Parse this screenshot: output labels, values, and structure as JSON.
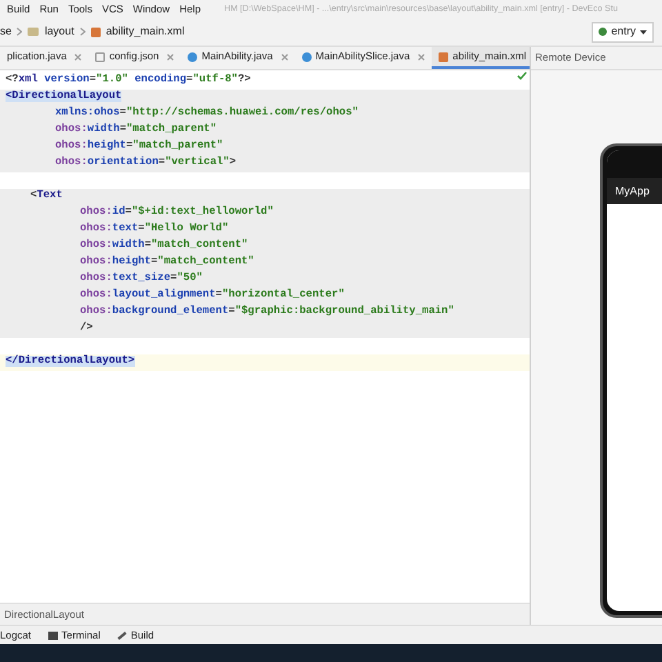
{
  "menu_bar": {
    "items": [
      "Build",
      "Run",
      "Tools",
      "VCS",
      "Window",
      "Help"
    ],
    "title": "HM [D:\\WebSpace\\HM] - ...\\entry\\src\\main\\resources\\base\\layout\\ability_main.xml [entry] - DevEco Stu"
  },
  "breadcrumb": [
    "se",
    "layout",
    "ability_main.xml"
  ],
  "run_config": "entry",
  "tabs": [
    {
      "label": "plication.java",
      "kind": "java",
      "selected": false
    },
    {
      "label": "config.json",
      "kind": "json",
      "selected": false
    },
    {
      "label": "MainAbility.java",
      "kind": "class",
      "selected": false
    },
    {
      "label": "MainAbilitySlice.java",
      "kind": "class",
      "selected": false
    },
    {
      "label": "ability_main.xml",
      "kind": "xml",
      "selected": true
    }
  ],
  "editor": {
    "lines": [
      {
        "kind": "element",
        "highlighted": false,
        "current": false,
        "tokens": [
          {
            "kind": "punct",
            "text": "<?"
          },
          {
            "kind": "tag",
            "text": "xml "
          },
          {
            "kind": "attr",
            "text": "version"
          },
          {
            "kind": "punct",
            "text": "="
          },
          {
            "kind": "value",
            "text": "\"1.0\" "
          },
          {
            "kind": "attr",
            "text": "encoding"
          },
          {
            "kind": "punct",
            "text": "="
          },
          {
            "kind": "value",
            "text": "\"utf-8\""
          },
          {
            "kind": "punct",
            "text": "?>"
          }
        ]
      },
      {
        "kind": "element",
        "highlighted": true,
        "current": false,
        "tokens": [
          {
            "kind": "match",
            "text": "<DirectionalLayout"
          }
        ],
        "children": [
          {
            "kind": "attribute",
            "highlighted": true,
            "current": false,
            "tokens": [
              {
                "kind": "attr",
                "text": "xmlns:ohos"
              },
              {
                "kind": "punct",
                "text": "="
              },
              {
                "kind": "value",
                "text": "\"http://schemas.huawei.com/res/ohos\""
              }
            ]
          },
          {
            "kind": "attribute",
            "highlighted": true,
            "current": false,
            "tokens": [
              {
                "kind": "ns",
                "text": "ohos:"
              },
              {
                "kind": "attr",
                "text": "width"
              },
              {
                "kind": "punct",
                "text": "="
              },
              {
                "kind": "value",
                "text": "\"match_parent\""
              }
            ]
          },
          {
            "kind": "attribute",
            "highlighted": true,
            "current": false,
            "tokens": [
              {
                "kind": "ns",
                "text": "ohos:"
              },
              {
                "kind": "attr",
                "text": "height"
              },
              {
                "kind": "punct",
                "text": "="
              },
              {
                "kind": "value",
                "text": "\"match_parent\""
              }
            ]
          },
          {
            "kind": "attribute",
            "highlighted": true,
            "current": false,
            "tokens": [
              {
                "kind": "ns",
                "text": "ohos:"
              },
              {
                "kind": "attr",
                "text": "orientation"
              },
              {
                "kind": "punct",
                "text": "="
              },
              {
                "kind": "value",
                "text": "\"vertical\""
              },
              {
                "kind": "punct",
                "text": ">"
              }
            ]
          },
          {
            "kind": "blank",
            "highlighted": false,
            "current": false
          },
          {
            "kind": "element",
            "highlighted": true,
            "current": false,
            "tokens": [
              {
                "kind": "punct",
                "text": "<"
              },
              {
                "kind": "tag",
                "text": "Text"
              }
            ],
            "children": [
              {
                "kind": "attribute",
                "highlighted": true,
                "current": false,
                "tokens": [
                  {
                    "kind": "ns",
                    "text": "ohos:"
                  },
                  {
                    "kind": "attr",
                    "text": "id"
                  },
                  {
                    "kind": "punct",
                    "text": "="
                  },
                  {
                    "kind": "value",
                    "text": "\"$+id:text_helloworld\""
                  }
                ]
              },
              {
                "kind": "attribute",
                "highlighted": true,
                "current": false,
                "tokens": [
                  {
                    "kind": "ns",
                    "text": "ohos:"
                  },
                  {
                    "kind": "attr",
                    "text": "text"
                  },
                  {
                    "kind": "punct",
                    "text": "="
                  },
                  {
                    "kind": "value",
                    "text": "\"Hello World\""
                  }
                ]
              },
              {
                "kind": "attribute",
                "highlighted": true,
                "current": false,
                "tokens": [
                  {
                    "kind": "ns",
                    "text": "ohos:"
                  },
                  {
                    "kind": "attr",
                    "text": "width"
                  },
                  {
                    "kind": "punct",
                    "text": "="
                  },
                  {
                    "kind": "value",
                    "text": "\"match_content\""
                  }
                ]
              },
              {
                "kind": "attribute",
                "highlighted": true,
                "current": false,
                "tokens": [
                  {
                    "kind": "ns",
                    "text": "ohos:"
                  },
                  {
                    "kind": "attr",
                    "text": "height"
                  },
                  {
                    "kind": "punct",
                    "text": "="
                  },
                  {
                    "kind": "value",
                    "text": "\"match_content\""
                  }
                ]
              },
              {
                "kind": "attribute",
                "highlighted": true,
                "current": false,
                "tokens": [
                  {
                    "kind": "ns",
                    "text": "ohos:"
                  },
                  {
                    "kind": "attr",
                    "text": "text_size"
                  },
                  {
                    "kind": "punct",
                    "text": "="
                  },
                  {
                    "kind": "value",
                    "text": "\"50\""
                  }
                ]
              },
              {
                "kind": "attribute",
                "highlighted": true,
                "current": false,
                "tokens": [
                  {
                    "kind": "ns",
                    "text": "ohos:"
                  },
                  {
                    "kind": "attr",
                    "text": "layout_alignment"
                  },
                  {
                    "kind": "punct",
                    "text": "="
                  },
                  {
                    "kind": "value",
                    "text": "\"horizontal_center\""
                  }
                ]
              },
              {
                "kind": "attribute",
                "highlighted": true,
                "current": false,
                "tokens": [
                  {
                    "kind": "ns",
                    "text": "ohos:"
                  },
                  {
                    "kind": "attr",
                    "text": "background_element"
                  },
                  {
                    "kind": "punct",
                    "text": "="
                  },
                  {
                    "kind": "value",
                    "text": "\"$graphic:background_ability_main\""
                  }
                ]
              },
              {
                "kind": "attribute",
                "highlighted": true,
                "current": false,
                "tokens": [
                  {
                    "kind": "punct",
                    "text": "/>"
                  }
                ]
              }
            ]
          },
          {
            "kind": "blank",
            "highlighted": false,
            "current": false
          }
        ]
      },
      {
        "kind": "element",
        "highlighted": false,
        "current": true,
        "tokens": [
          {
            "kind": "match",
            "text": "</DirectionalLayout>"
          }
        ]
      }
    ]
  },
  "editor_breadcrumb": "DirectionalLayout",
  "remote_device": {
    "title": "Remote Device",
    "app_title": "MyApp"
  },
  "tool_windows": [
    {
      "label": "Logcat",
      "kind": "logcat"
    },
    {
      "label": "Terminal",
      "kind": "terminal"
    },
    {
      "label": "Build",
      "kind": "build"
    }
  ]
}
